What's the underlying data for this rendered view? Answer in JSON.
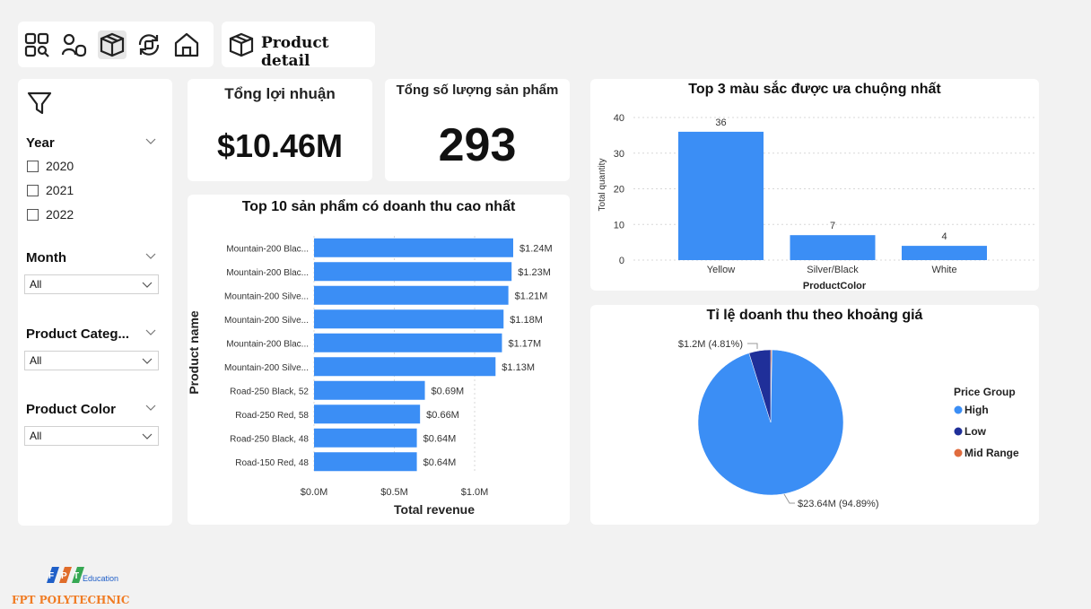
{
  "navigation": {
    "icons": [
      "dashboard-grid-icon",
      "user-group-icon",
      "product-box-icon",
      "refresh-icon",
      "home-icon"
    ],
    "active": "product-box-icon"
  },
  "page": {
    "title": "Product detail"
  },
  "filters": {
    "year": {
      "label": "Year",
      "options": [
        "2020",
        "2021",
        "2022"
      ]
    },
    "month": {
      "label": "Month",
      "value": "All"
    },
    "category": {
      "label": "Product Categ...",
      "value": "All"
    },
    "color": {
      "label": "Product Color",
      "value": "All"
    }
  },
  "kpis": {
    "profit": {
      "label": "Tổng lợi nhuận",
      "value": "$10.46M"
    },
    "quantity": {
      "label": "Tổng số lượng sản phẩm",
      "value": "293"
    }
  },
  "colors": {
    "bar": "#3b8ef5",
    "low": "#1f2f99",
    "mid": "#e06c3e",
    "card": "#ffffff",
    "background": "#f2f2f2"
  },
  "chart_data": [
    {
      "type": "bar",
      "orientation": "horizontal",
      "title": "Top 10 sản phẩm có doanh thu cao nhất",
      "xlabel": "Total revenue",
      "ylabel": "Product name",
      "categories": [
        "Mountain-200 Blac...",
        "Mountain-200 Blac...",
        "Mountain-200 Silve...",
        "Mountain-200 Silve...",
        "Mountain-200 Blac...",
        "Mountain-200 Silve...",
        "Road-250 Black, 52",
        "Road-250 Red, 58",
        "Road-250 Black, 48",
        "Road-150 Red, 48"
      ],
      "values": [
        1.24,
        1.23,
        1.21,
        1.18,
        1.17,
        1.13,
        0.69,
        0.66,
        0.64,
        0.64
      ],
      "labels": [
        "$1.24M",
        "$1.23M",
        "$1.21M",
        "$1.18M",
        "$1.17M",
        "$1.13M",
        "$0.69M",
        "$0.66M",
        "$0.64M",
        "$0.64M"
      ],
      "xticks": [
        0.0,
        0.5,
        1.0
      ],
      "xtick_labels": [
        "$0.0M",
        "$0.5M",
        "$1.0M"
      ],
      "xlim": [
        0,
        1.24
      ]
    },
    {
      "type": "bar",
      "title": "Top 3 màu sắc được ưa chuộng nhất",
      "xlabel": "ProductColor",
      "ylabel": "Total quantity",
      "categories": [
        "Yellow",
        "Silver/Black",
        "White"
      ],
      "values": [
        36,
        7,
        4
      ],
      "yticks": [
        0,
        10,
        20,
        30,
        40
      ],
      "ylim": [
        0,
        40
      ]
    },
    {
      "type": "pie",
      "title": "Tỉ lệ doanh thu theo khoảng giá",
      "legend_title": "Price Group",
      "legend_placement": "right",
      "slices": [
        {
          "name": "High",
          "value": 23.64,
          "percent": 94.89,
          "label": "$23.64M (94.89%)"
        },
        {
          "name": "Low",
          "value": 1.2,
          "percent": 4.81,
          "label": "$1.2M (4.81%)"
        },
        {
          "name": "Mid Range",
          "value": 0.07,
          "percent": 0.3,
          "label": ""
        }
      ]
    }
  ],
  "branding": {
    "logo_text": "FPT",
    "sub": "Education",
    "name": "FPT POLYTECHNIC"
  }
}
